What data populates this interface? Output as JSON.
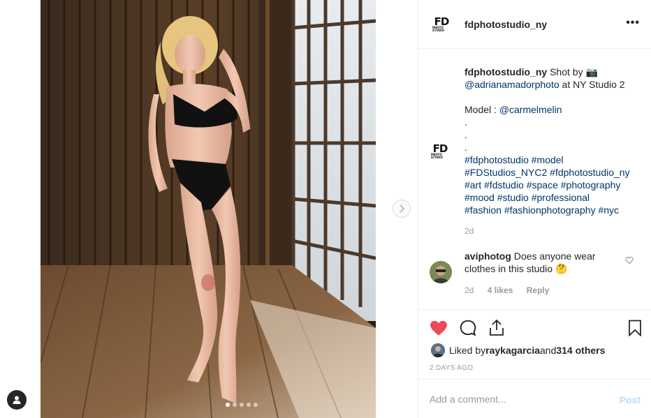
{
  "post": {
    "username": "fdphotostudio_ny",
    "logo_text": "FD",
    "logo_sub": "PHOTO STUDIO",
    "more_label": "•••",
    "image_alt": "Photo of model standing in studio",
    "carousel": {
      "count": 5,
      "active": 0
    }
  },
  "caption": {
    "username": "fdphotostudio_ny",
    "text1": " Shot by 📷",
    "mention1": "@adrianamadorphoto",
    "text2": " at NY Studio 2",
    "model_label": "Model : ",
    "mention2": "@carmelmelin",
    "dot": ".",
    "hashtags": [
      "#fdphotostudio #model",
      "#FDStudios_NYC2 #fdphotostudio_ny",
      "#art #fdstudio #space #photography",
      "#mood #studio #professional",
      "#fashion #fashionphotography #nyc"
    ],
    "age": "2d"
  },
  "comment": {
    "username": "aviphotog",
    "text": " Does anyone wear clothes in this studio 🤔",
    "age": "2d",
    "likes": "4 likes",
    "reply": "Reply"
  },
  "likes": {
    "prefix": "Liked by ",
    "user": "raykagarcia",
    "middle": " and ",
    "others": "314 others"
  },
  "timestamp": "2 DAYS AGO",
  "composer": {
    "placeholder": "Add a comment...",
    "post_label": "Post"
  },
  "colors": {
    "heart": "#ed4956",
    "link": "#003569",
    "muted": "#999999",
    "post_disabled": "#b2dffc"
  }
}
